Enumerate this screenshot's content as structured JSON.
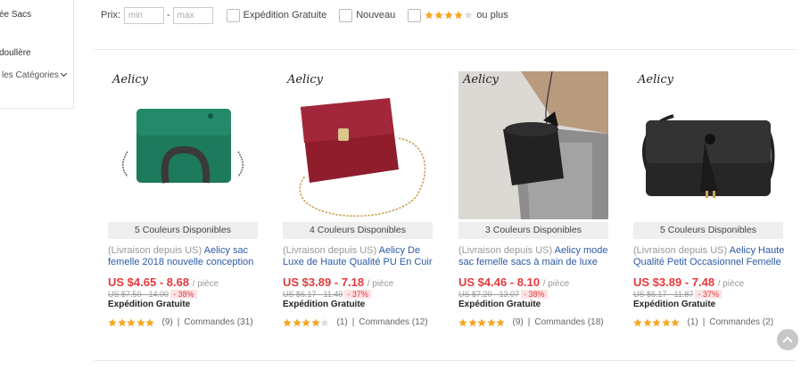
{
  "sidebar": {
    "items": [
      {
        "label": "ée Sacs"
      },
      {
        "label": "doullère"
      }
    ],
    "all_categories": "les Catégories"
  },
  "filters": {
    "price_label": "Prix:",
    "min_placeholder": "min",
    "max_placeholder": "max",
    "dash": "-",
    "free_shipping": "Expédition Gratuite",
    "new": "Nouveau",
    "rating_suffix": "ou plus",
    "rating_stars": 4
  },
  "colors": {
    "star": "#f5a623",
    "star_empty": "#dddddd",
    "price": "#e4393c",
    "title": "#2d5aa6"
  },
  "products": [
    {
      "brand": "Aelicy",
      "colors_available": "5 Couleurs Disponibles",
      "origin": "(Livraison depuis US)",
      "title": "Aelicy sac femelle 2018 nouvelle conception",
      "price": "US $4.65 - 8.68",
      "unit": "/ pièce",
      "original_price": "US $7.50 - 14.00",
      "discount": "- 38%",
      "shipping": "Expédition Gratuite",
      "stars": 5,
      "reviews": "(9)",
      "orders": "Commandes (31)"
    },
    {
      "brand": "Aelicy",
      "colors_available": "4 Couleurs Disponibles",
      "origin": "(Livraison depuis US)",
      "title": "Aelicy De Luxe de Haute Qualité PU En Cuir",
      "price": "US $3.89 - 7.18",
      "unit": "/ pièce",
      "original_price": "US $6.17 - 11.40",
      "discount": "- 37%",
      "shipping": "Expédition Gratuite",
      "stars": 4,
      "reviews": "(1)",
      "orders": "Commandes (12)"
    },
    {
      "brand": "Aelicy",
      "colors_available": "3 Couleurs Disponibles",
      "origin": "(Livraison depuis US)",
      "title": "Aelicy mode sac femelle sacs à main de luxe",
      "price": "US $4.46 - 8.10",
      "unit": "/ pièce",
      "original_price": "US $7.20 - 13.07",
      "discount": "- 38%",
      "shipping": "Expédition Gratuite",
      "stars": 5,
      "reviews": "(9)",
      "orders": "Commandes (18)"
    },
    {
      "brand": "Aelicy",
      "colors_available": "5 Couleurs Disponibles",
      "origin": "(Livraison depuis US)",
      "title": "Aelicy Haute Qualité Petit Occasionnel Femelle",
      "price": "US $3.89 - 7.48",
      "unit": "/ pièce",
      "original_price": "US $6.17 - 11.87",
      "discount": "- 37%",
      "shipping": "Expédition Gratuite",
      "stars": 5,
      "reviews": "(1)",
      "orders": "Commandes (2)"
    }
  ]
}
